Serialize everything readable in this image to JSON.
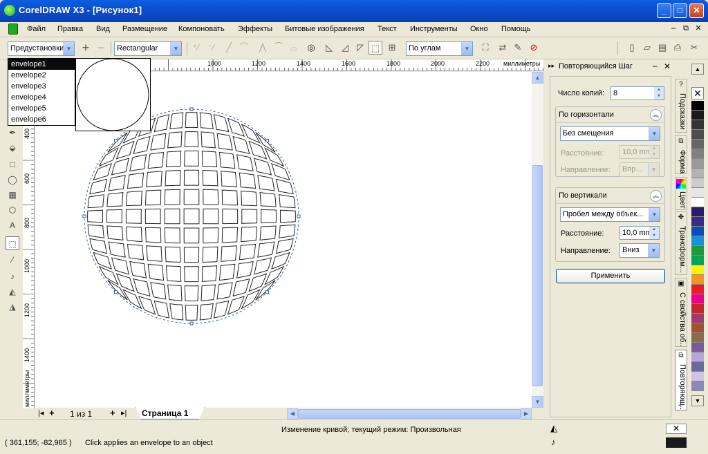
{
  "window": {
    "title": "CorelDRAW X3 - [Рисунок1]",
    "buttons": {
      "minimize": "_",
      "maximize": "□",
      "close": "✕"
    }
  },
  "menu": [
    "Файл",
    "Правка",
    "Вид",
    "Размещение",
    "Компоновать",
    "Эффекты",
    "Битовые изображения",
    "Текст",
    "Инструменты",
    "Окно",
    "Помощь"
  ],
  "propbar": {
    "preset_value": "Предустановки",
    "shape_mode": "Rectangular",
    "mapping_mode": "По углам"
  },
  "preset_dropdown": {
    "options": [
      "envelope1",
      "envelope2",
      "envelope3",
      "envelope4",
      "envelope5",
      "envelope6"
    ],
    "selected": "envelope1"
  },
  "ruler": {
    "h_labels": [
      "1000",
      "1200",
      "1400",
      "1600",
      "1800",
      "2000",
      "2200"
    ],
    "h_units": "миллиметры",
    "v_labels": [
      "400",
      "600",
      "800",
      "1000",
      "1200",
      "1400"
    ],
    "v_units": "миллиметры"
  },
  "page_nav": {
    "counter": "1 из 1",
    "tab": "Страница 1"
  },
  "status": {
    "mode": "Изменение кривой;  текущий режим: Произвольная",
    "coords": "( 361,155; -82,965 )",
    "hint": "Click applies an envelope to an object"
  },
  "docker": {
    "title": "Повторяющийся Шаг",
    "copies_label": "Число копий:",
    "copies_value": "8",
    "horizontal": {
      "header": "По горизонтали",
      "mode": "Без смещения",
      "distance_label": "Расстояние:",
      "distance_value": "10,0 mm",
      "direction_label": "Направление:",
      "direction_value": "Впр..."
    },
    "vertical": {
      "header": "По вертикали",
      "mode": "Пробел между объек...",
      "distance_label": "Расстояние:",
      "distance_value": "10,0 mm",
      "direction_label": "Направление:",
      "direction_value": "Вниз"
    },
    "apply_label": "Применить"
  },
  "side_tabs": [
    "Подсказки",
    "Форма",
    "Цвет",
    "Трансформ...",
    "С свойства об...",
    "Повторяющ..."
  ],
  "palette_colors": [
    "#000000",
    "#1a1a1a",
    "#333333",
    "#4d4d4d",
    "#666666",
    "#808080",
    "#999999",
    "#b3b3b3",
    "#cccccc",
    "#e6e6e6",
    "#ffffff",
    "#2b1b6b",
    "#3a2a8a",
    "#0a4fb8",
    "#1a8fdd",
    "#1e9a3c",
    "#00a651",
    "#fff200",
    "#f7941d",
    "#ed1c24",
    "#ec008c",
    "#c1272d",
    "#9e3a6e",
    "#a0522d",
    "#8b6b4a",
    "#7a5a9a",
    "#b7a6d9",
    "#6a6a9a",
    "#cfc4e6",
    "#8b8bb5"
  ]
}
